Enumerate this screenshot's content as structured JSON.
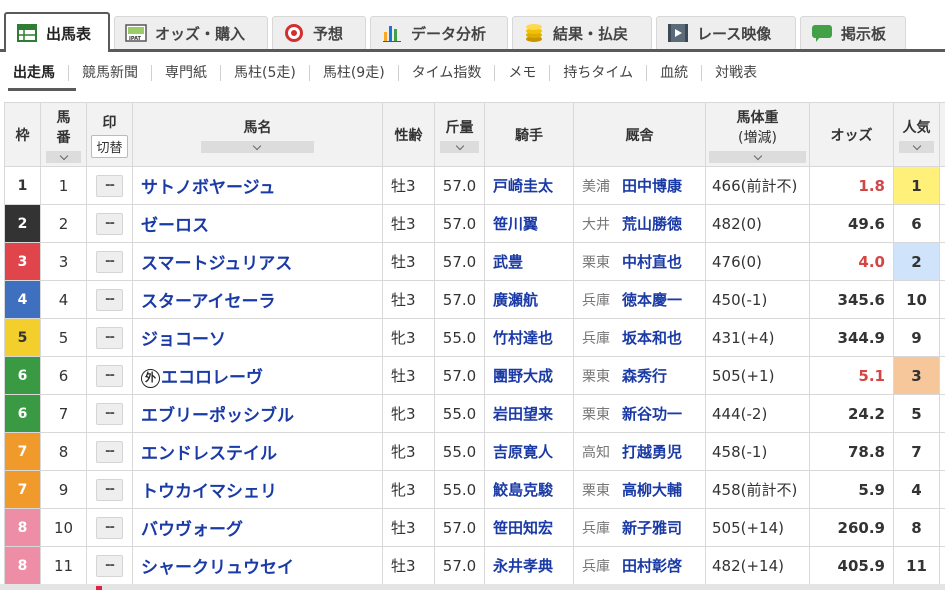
{
  "tabs": [
    {
      "label": "出馬表",
      "icon": "table-icon",
      "color": "#2e7d32"
    },
    {
      "label": "オッズ・購入",
      "icon": "ipat-icon",
      "color": "#5a5a5a"
    },
    {
      "label": "予想",
      "icon": "target-icon",
      "color": "#d32f2f"
    },
    {
      "label": "データ分析",
      "icon": "bar-chart-icon",
      "color": "#1976d2"
    },
    {
      "label": "結果・払戻",
      "icon": "coins-icon",
      "color": "#d4a000"
    },
    {
      "label": "レース映像",
      "icon": "video-icon",
      "color": "#555555"
    },
    {
      "label": "掲示板",
      "icon": "chat-bubble-icon",
      "color": "#43a047"
    }
  ],
  "subnav": [
    "出走馬",
    "競馬新聞",
    "専門紙",
    "馬柱(5走)",
    "馬柱(9走)",
    "タイム指数",
    "メモ",
    "持ちタイム",
    "血統",
    "対戦表"
  ],
  "headers": {
    "waku": "枠",
    "umaban_1": "馬",
    "umaban_2": "番",
    "mark": "印",
    "mark_switch": "切替",
    "name": "馬名",
    "sex_age": "性齢",
    "kinryo": "斤量",
    "jockey": "騎手",
    "stable": "厩舎",
    "body_weight_1": "馬体重",
    "body_weight_2": "(増減)",
    "odds": "オッズ",
    "popularity": "人気"
  },
  "mark_placeholder": "--",
  "foreign_badge": "外",
  "waku_colors": {
    "1": {
      "bg": "#ffffff",
      "fg": "#333333"
    },
    "2": {
      "bg": "#333333",
      "fg": "#ffffff"
    },
    "3": {
      "bg": "#e0454b",
      "fg": "#ffffff"
    },
    "4": {
      "bg": "#3f6fbf",
      "fg": "#ffffff"
    },
    "5": {
      "bg": "#f2cf2c",
      "fg": "#333333"
    },
    "6": {
      "bg": "#3a9a43",
      "fg": "#ffffff"
    },
    "7": {
      "bg": "#ef9a2a",
      "fg": "#ffffff"
    },
    "8": {
      "bg": "#ee8ea6",
      "fg": "#ffffff"
    }
  },
  "popularity_colors": {
    "1": "#fff07a",
    "2": "#cfe3fb",
    "3": "#f6c79a"
  },
  "odds_highlight_color": "#d24646",
  "horses": [
    {
      "waku": "1",
      "umaban": "1",
      "name": "サトノボヤージュ",
      "foreign": false,
      "sex_age": "牡3",
      "kinryo": "57.0",
      "jockey": "戸崎圭太",
      "region": "美浦",
      "trainer": "田中博康",
      "weight": "466(前計不)",
      "odds": "1.8",
      "pop": "1"
    },
    {
      "waku": "2",
      "umaban": "2",
      "name": "ゼーロス",
      "foreign": false,
      "sex_age": "牡3",
      "kinryo": "57.0",
      "jockey": "笹川翼",
      "region": "大井",
      "trainer": "荒山勝徳",
      "weight": "482(0)",
      "odds": "49.6",
      "pop": "6"
    },
    {
      "waku": "3",
      "umaban": "3",
      "name": "スマートジュリアス",
      "foreign": false,
      "sex_age": "牡3",
      "kinryo": "57.0",
      "jockey": "武豊",
      "region": "栗東",
      "trainer": "中村直也",
      "weight": "476(0)",
      "odds": "4.0",
      "pop": "2"
    },
    {
      "waku": "4",
      "umaban": "4",
      "name": "スターアイセーラ",
      "foreign": false,
      "sex_age": "牡3",
      "kinryo": "57.0",
      "jockey": "廣瀬航",
      "region": "兵庫",
      "trainer": "徳本慶一",
      "weight": "450(-1)",
      "odds": "345.6",
      "pop": "10"
    },
    {
      "waku": "5",
      "umaban": "5",
      "name": "ジョコーソ",
      "foreign": false,
      "sex_age": "牝3",
      "kinryo": "55.0",
      "jockey": "竹村達也",
      "region": "兵庫",
      "trainer": "坂本和也",
      "weight": "431(+4)",
      "odds": "344.9",
      "pop": "9"
    },
    {
      "waku": "6",
      "umaban": "6",
      "name": "エコロレーヴ",
      "foreign": true,
      "sex_age": "牡3",
      "kinryo": "57.0",
      "jockey": "團野大成",
      "region": "栗東",
      "trainer": "森秀行",
      "weight": "505(+1)",
      "odds": "5.1",
      "pop": "3"
    },
    {
      "waku": "6",
      "umaban": "7",
      "name": "エブリーポッシブル",
      "foreign": false,
      "sex_age": "牝3",
      "kinryo": "55.0",
      "jockey": "岩田望来",
      "region": "栗東",
      "trainer": "新谷功一",
      "weight": "444(-2)",
      "odds": "24.2",
      "pop": "5"
    },
    {
      "waku": "7",
      "umaban": "8",
      "name": "エンドレステイル",
      "foreign": false,
      "sex_age": "牝3",
      "kinryo": "55.0",
      "jockey": "吉原寛人",
      "region": "高知",
      "trainer": "打越勇児",
      "weight": "458(-1)",
      "odds": "78.8",
      "pop": "7"
    },
    {
      "waku": "7",
      "umaban": "9",
      "name": "トウカイマシェリ",
      "foreign": false,
      "sex_age": "牝3",
      "kinryo": "55.0",
      "jockey": "鮫島克駿",
      "region": "栗東",
      "trainer": "高柳大輔",
      "weight": "458(前計不)",
      "odds": "5.9",
      "pop": "4"
    },
    {
      "waku": "8",
      "umaban": "10",
      "name": "バウヴォーグ",
      "foreign": false,
      "sex_age": "牡3",
      "kinryo": "57.0",
      "jockey": "笹田知宏",
      "region": "兵庫",
      "trainer": "新子雅司",
      "weight": "505(+14)",
      "odds": "260.9",
      "pop": "8"
    },
    {
      "waku": "8",
      "umaban": "11",
      "name": "シャークリュウセイ",
      "foreign": false,
      "sex_age": "牡3",
      "kinryo": "57.0",
      "jockey": "永井孝典",
      "region": "兵庫",
      "trainer": "田村彰啓",
      "weight": "482(+14)",
      "odds": "405.9",
      "pop": "11"
    }
  ]
}
